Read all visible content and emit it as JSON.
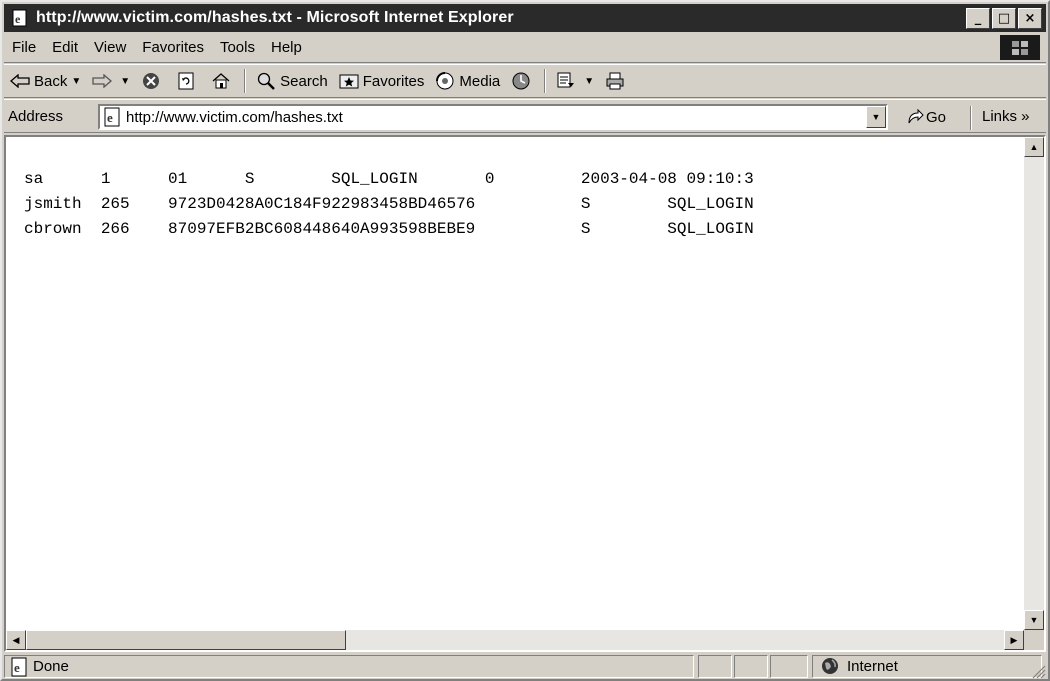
{
  "window": {
    "title": "http://www.victim.com/hashes.txt - Microsoft Internet Explorer",
    "controls": [
      "_",
      "□",
      "×"
    ]
  },
  "menu": [
    "File",
    "Edit",
    "View",
    "Favorites",
    "Tools",
    "Help"
  ],
  "toolbar": {
    "back": "Back",
    "search": "Search",
    "favorites": "Favorites",
    "media": "Media"
  },
  "address": {
    "label": "Address",
    "url": "http://www.victim.com/hashes.txt",
    "go": "Go",
    "links": "Links »"
  },
  "document": {
    "lines": [
      "sa      1      01      S        SQL_LOGIN       0         2003-04-08 09:10:3",
      "jsmith  265    9723D0428A0C184F922983458BD46576           S        SQL_LOGIN",
      "cbrown  266    87097EFB2BC608448640A993598BEBE9           S        SQL_LOGIN"
    ]
  },
  "status": {
    "text": "Done",
    "zone": "Internet"
  },
  "icons": {
    "app": "ie-page-icon",
    "throbber": "windows-flag-icon",
    "back": "back-arrow-icon",
    "forward": "forward-arrow-icon",
    "stop": "stop-icon",
    "refresh": "refresh-icon",
    "home": "home-icon",
    "search": "search-icon",
    "favorites": "favorites-icon",
    "media": "media-icon",
    "history": "history-icon",
    "mail": "mail-icon",
    "print": "print-icon",
    "go": "go-arrow-icon",
    "internet": "globe-icon"
  }
}
